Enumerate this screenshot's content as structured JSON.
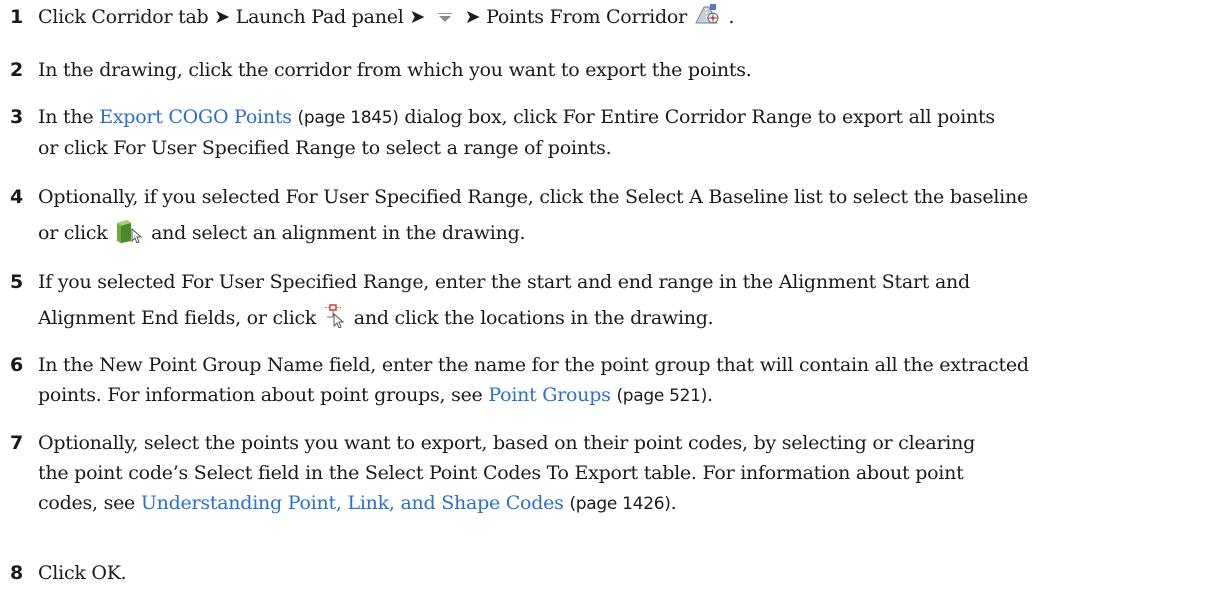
{
  "steps": [
    {
      "num": "1",
      "t1": "Click Corridor tab ➤ Launch Pad panel ➤",
      "t2": "➤ Points From Corridor",
      "t3": ".",
      "icons": [
        "dropdown-arrow-icon",
        "points-from-corridor-icon"
      ]
    },
    {
      "num": "2",
      "t1": "In the drawing, click the corridor from which you want to export the points."
    },
    {
      "num": "3",
      "t1": "In the",
      "link": "Export COGO Points",
      "ref": "(page 1845)",
      "t2": "dialog box, click For Entire Corridor Range to export all points",
      "t3": "or click For User Specified Range to select a range of points."
    },
    {
      "num": "4",
      "t1": "Optionally, if you selected For User Specified Range, click the Select A Baseline list to select the baseline",
      "t2": "or click",
      "t3": "and select an alignment in the drawing.",
      "icons": [
        "select-alignment-icon"
      ]
    },
    {
      "num": "5",
      "t1": "If you selected For User Specified Range, enter the start and end range in the Alignment Start and",
      "t2": "Alignment End fields, or click",
      "t3": "and click the locations in the drawing.",
      "icons": [
        "pick-location-icon"
      ]
    },
    {
      "num": "6",
      "t1": "In the New Point Group Name field, enter the name for the point group that will contain all the extracted",
      "t2": "points. For information about point groups, see",
      "link": "Point Groups",
      "ref": "(page 521)",
      "t3": "."
    },
    {
      "num": "7",
      "t1": "Optionally, select the points you want to export, based on their point codes, by selecting or clearing",
      "t2": "the point code’s Select field in the Select Point Codes To Export table. For information about point",
      "t3": "codes, see",
      "link": "Understanding Point, Link, and Shape Codes",
      "ref": "(page 1426)",
      "t4": "."
    },
    {
      "num": "8",
      "t1": "Click OK."
    }
  ],
  "colors": {
    "link": "#2a6fc9",
    "text": "#1a1a1a"
  }
}
